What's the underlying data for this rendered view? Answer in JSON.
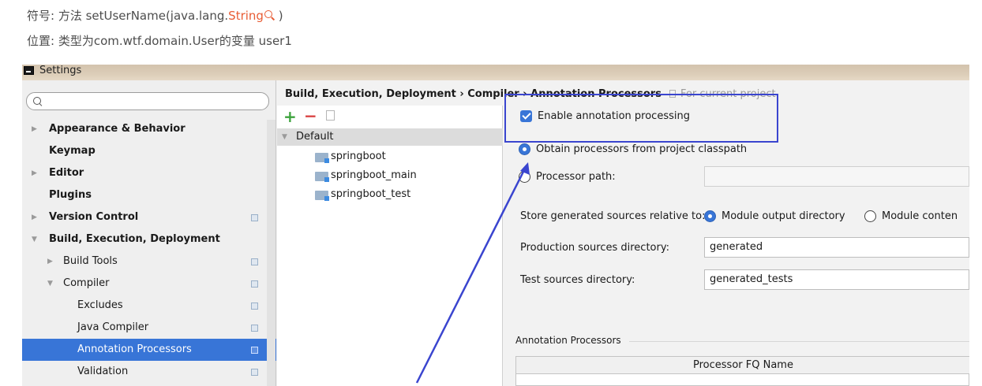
{
  "article": {
    "line1_prefix": "符号: 方法 setUserName(java.lang.",
    "line1_link": "String",
    "line1_suffix": " )",
    "line2": "位置: 类型为com.wtf.domain.User的变量 user1"
  },
  "window": {
    "title": "Settings"
  },
  "sidebar": {
    "search_value": "",
    "items": [
      {
        "label": "Appearance & Behavior",
        "arrow": "▶"
      },
      {
        "label": "Keymap",
        "arrow": ""
      },
      {
        "label": "Editor",
        "arrow": "▶"
      },
      {
        "label": "Plugins",
        "arrow": ""
      },
      {
        "label": "Version Control",
        "arrow": "▶"
      },
      {
        "label": "Build, Execution, Deployment",
        "arrow": "▼"
      },
      {
        "label": "Build Tools",
        "arrow": "▶"
      },
      {
        "label": "Compiler",
        "arrow": "▼"
      },
      {
        "label": "Excludes",
        "arrow": ""
      },
      {
        "label": "Java Compiler",
        "arrow": ""
      },
      {
        "label": "Annotation Processors",
        "arrow": ""
      },
      {
        "label": "Validation",
        "arrow": ""
      }
    ]
  },
  "breadcrumb": {
    "part1": "Build, Execution, Deployment",
    "sep1": " › ",
    "part2": "Compiler",
    "sep2": " › ",
    "part3": "Annotation Processors",
    "scope": "For current project"
  },
  "modules": {
    "add": "+",
    "remove": "−",
    "root_arrow": "▼",
    "root": "Default",
    "items": [
      "springboot",
      "springboot_main",
      "springboot_test"
    ]
  },
  "settings": {
    "enable_label": "Enable annotation processing",
    "enable_checked": true,
    "obtain_label": "Obtain processors from project classpath",
    "processor_path_label": "Processor path:",
    "processor_path_value": "",
    "store_label": "Store generated sources relative to:",
    "module_output_label": "Module output directory",
    "module_content_label": "Module conten",
    "production_label": "Production sources directory:",
    "production_value": "generated",
    "test_label": "Test sources directory:",
    "test_value": "generated_tests",
    "group_label": "Annotation Processors",
    "table_header": "Processor FQ Name"
  },
  "colors": {
    "accent_blue": "#3875d7",
    "annotation_arrow": "#3a45cf",
    "link_orange": "#e85c34"
  }
}
